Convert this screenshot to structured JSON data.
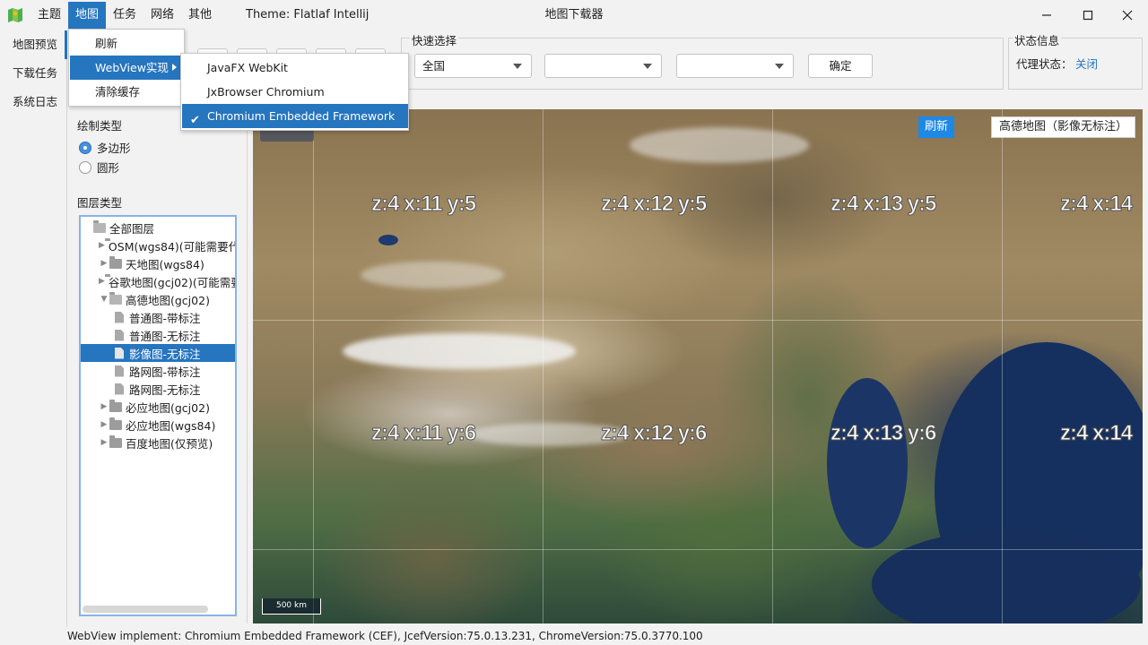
{
  "window": {
    "title": "地图下载器",
    "theme_label": "Theme: Flatlaf Intellij"
  },
  "menubar": [
    "主题",
    "地图",
    "任务",
    "网络",
    "其他"
  ],
  "menu_dropdown": {
    "items": [
      "刷新",
      "WebView实现",
      "清除缓存"
    ],
    "highlighted": "WebView实现"
  },
  "webview_submenu": {
    "items": [
      "JavaFX WebKit",
      "JxBrowser Chromium",
      "Chromium Embedded Framework"
    ],
    "checked": "Chromium Embedded Framework"
  },
  "left_nav": [
    "地图预览",
    "下载任务",
    "系统日志"
  ],
  "draw_type": {
    "title": "绘制类型",
    "options": [
      "多边形",
      "圆形"
    ],
    "selected": "多边形"
  },
  "layer_type": {
    "title": "图层类型",
    "tree": [
      {
        "label": "全部图层",
        "level": 0,
        "kind": "folder-open",
        "expanded": true
      },
      {
        "label": "OSM(wgs84)(可能需要代",
        "level": 1,
        "kind": "folder",
        "expanded": false
      },
      {
        "label": "天地图(wgs84)",
        "level": 1,
        "kind": "folder",
        "expanded": false
      },
      {
        "label": "谷歌地图(gcj02)(可能需要",
        "level": 1,
        "kind": "folder",
        "expanded": false
      },
      {
        "label": "高德地图(gcj02)",
        "level": 1,
        "kind": "folder",
        "expanded": true
      },
      {
        "label": "普通图-带标注",
        "level": 2,
        "kind": "file"
      },
      {
        "label": "普通图-无标注",
        "level": 2,
        "kind": "file"
      },
      {
        "label": "影像图-无标注",
        "level": 2,
        "kind": "file",
        "selected": true
      },
      {
        "label": "路网图-带标注",
        "level": 2,
        "kind": "file"
      },
      {
        "label": "路网图-无标注",
        "level": 2,
        "kind": "file"
      },
      {
        "label": "必应地图(gcj02)",
        "level": 1,
        "kind": "folder",
        "expanded": false
      },
      {
        "label": "必应地图(wgs84)",
        "level": 1,
        "kind": "folder",
        "expanded": false
      },
      {
        "label": "百度地图(仅预览)",
        "level": 1,
        "kind": "folder",
        "expanded": false
      }
    ]
  },
  "quick_select": {
    "title": "快速选择",
    "combo1": "全国",
    "combo2": "",
    "combo3": "",
    "confirm": "确定"
  },
  "status_info": {
    "title": "状态信息",
    "proxy_label": "代理状态：",
    "proxy_value": "关闭"
  },
  "map": {
    "refresh": "刷新",
    "layer_name": "高德地图（影像无标注）",
    "scale": "500 km",
    "tiles": [
      "z:4 x:11 y:5",
      "z:4 x:12 y:5",
      "z:4 x:13 y:5",
      "z:4 x:14",
      "z:4 x:11 y:6",
      "z:4 x:12 y:6",
      "z:4 x:13 y:6",
      "z:4 x:14"
    ]
  },
  "statusbar": "WebView implement: Chromium Embedded Framework (CEF), JcefVersion:75.0.13.231, ChromeVersion:75.0.3770.100",
  "colors": {
    "accent": "#2675bf",
    "map_refresh": "#1e88e5",
    "proxy_value": "#2675bf"
  }
}
